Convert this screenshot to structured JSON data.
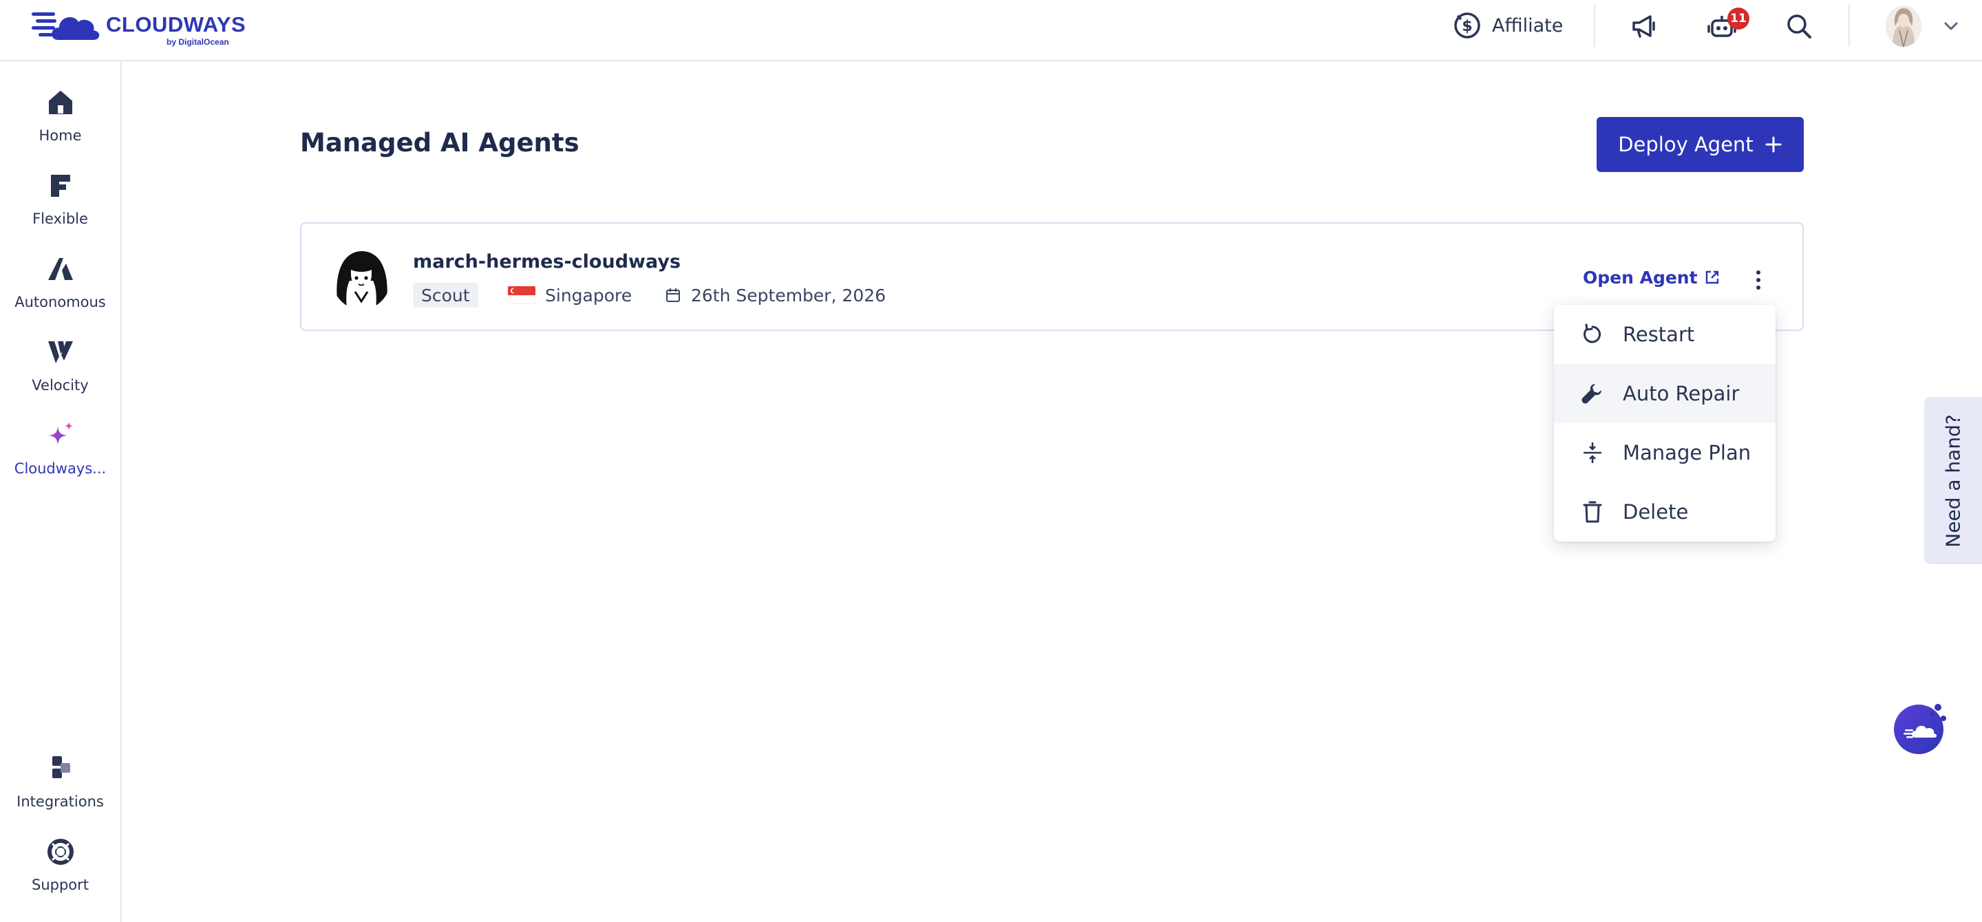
{
  "brand": {
    "name": "CLOUDWAYS",
    "sub": "by DigitalOcean",
    "accent": "#2d36b8"
  },
  "topbar": {
    "affiliate_label": "Affiliate",
    "notification_count": "11",
    "icons": [
      "dollar-circle-icon",
      "megaphone-icon",
      "robot-icon",
      "search-icon",
      "user-avatar",
      "chevron-down-icon"
    ]
  },
  "sidebar": {
    "items": [
      {
        "label": "Home",
        "icon": "home-icon"
      },
      {
        "label": "Flexible",
        "icon": "flexible-icon"
      },
      {
        "label": "Autonomous",
        "icon": "autonomous-icon"
      },
      {
        "label": "Velocity",
        "icon": "velocity-icon"
      },
      {
        "label": "Cloudways...",
        "icon": "sparkle-icon",
        "active": true
      }
    ],
    "bottom": [
      {
        "label": "Integrations",
        "icon": "integrations-icon"
      },
      {
        "label": "Support",
        "icon": "lifebuoy-icon"
      }
    ]
  },
  "main": {
    "title": "Managed AI Agents",
    "deploy_label": "Deploy Agent"
  },
  "agent": {
    "name": "march-hermes-cloudways",
    "plan": "Scout",
    "location": "Singapore",
    "date": "26th September, 2026",
    "open_label": "Open Agent"
  },
  "menu": {
    "items": [
      {
        "label": "Restart",
        "icon": "restart-icon"
      },
      {
        "label": "Auto Repair",
        "icon": "wrench-icon"
      },
      {
        "label": "Manage Plan",
        "icon": "compress-icon"
      },
      {
        "label": "Delete",
        "icon": "trash-icon"
      }
    ]
  },
  "help": {
    "label": "Need a hand?"
  }
}
